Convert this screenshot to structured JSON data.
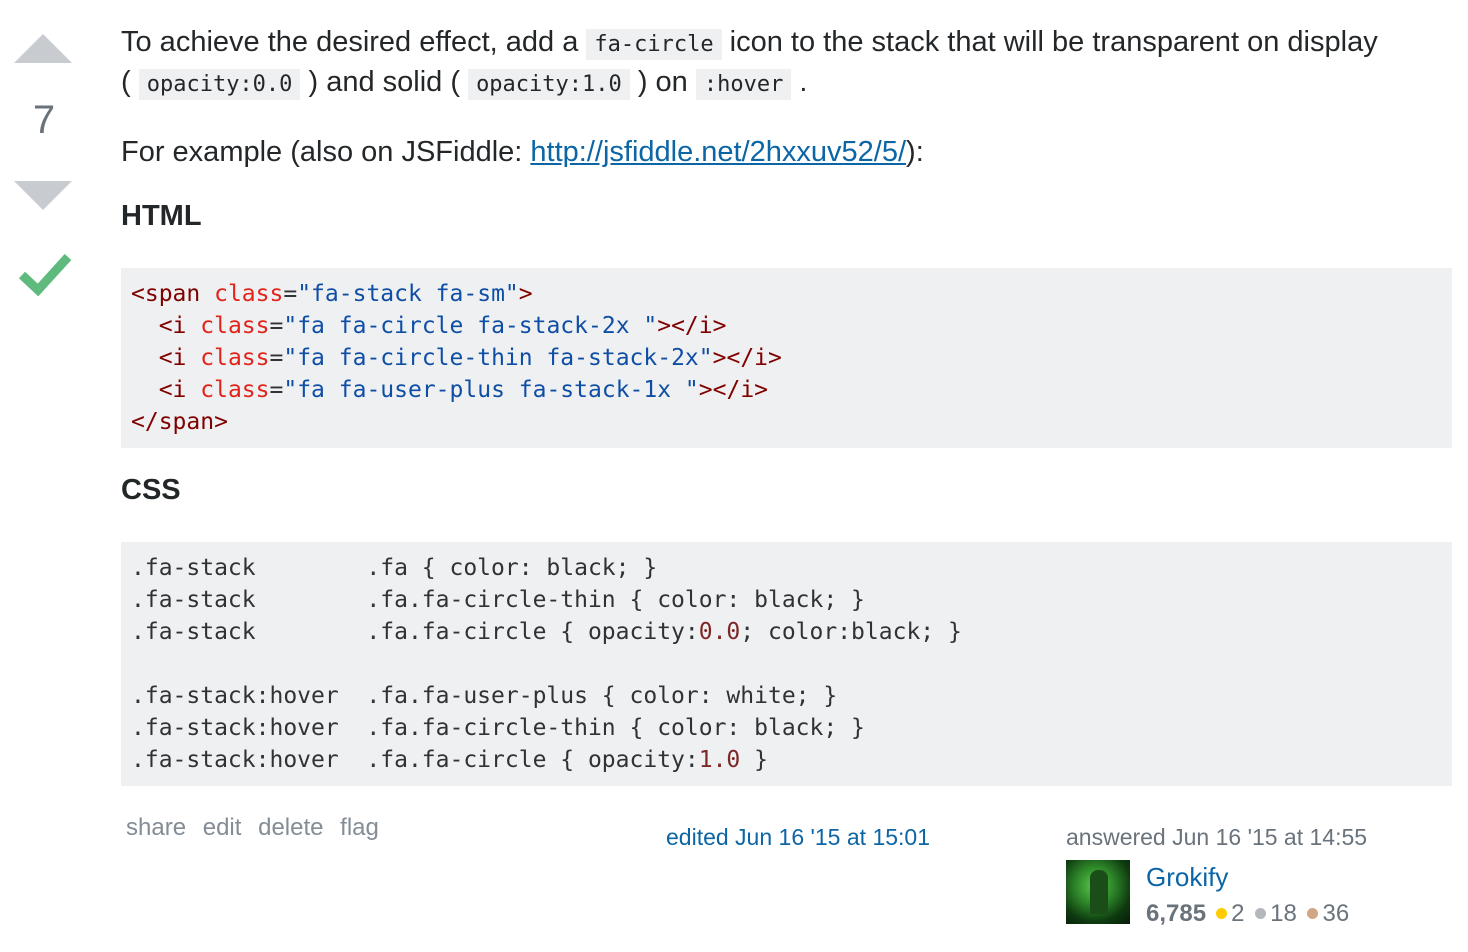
{
  "vote": {
    "count": "7"
  },
  "colors": {
    "accepted": "#5eba7d",
    "link": "#0c65a5",
    "gold": "#ffcc01",
    "silver": "#b4b8bc",
    "bronze": "#d1a684"
  },
  "body": {
    "p1": {
      "t1": "To achieve the desired effect, add a ",
      "c1": "fa-circle",
      "t2": " icon to the stack that will be transparent on display",
      "t3": "( ",
      "c2": "opacity:0.0",
      "t4": " ) and solid ( ",
      "c3": "opacity:1.0",
      "t5": " ) on ",
      "c4": ":hover",
      "t6": " ."
    },
    "p2": {
      "t1": "For example (also on JSFiddle: ",
      "link": "http://jsfiddle.net/2hxxuv52/5/",
      "t2": "):"
    },
    "heading_html": "HTML",
    "heading_css": "CSS"
  },
  "code_html": {
    "l1": {
      "open": "<span ",
      "attr": "class",
      "eq": "=",
      "val": "\"fa-stack fa-sm\"",
      "close": ">"
    },
    "l2": {
      "open": "  <i ",
      "attr": "class",
      "eq": "=",
      "val": "\"fa fa-circle fa-stack-2x \"",
      "close": "></i>"
    },
    "l3": {
      "open": "  <i ",
      "attr": "class",
      "eq": "=",
      "val": "\"fa fa-circle-thin fa-stack-2x\"",
      "close": "></i>"
    },
    "l4": {
      "open": "  <i ",
      "attr": "class",
      "eq": "=",
      "val": "\"fa fa-user-plus fa-stack-1x \"",
      "close": "></i>"
    },
    "l5": "</span>"
  },
  "code_css": {
    "l1": ".fa-stack        .fa { color: black; }",
    "l2": ".fa-stack        .fa.fa-circle-thin { color: black; }",
    "l3a": ".fa-stack        .fa.fa-circle { opacity:",
    "l3n": "0.0",
    "l3b": "; color:black; }",
    "l4": ".fa-stack:hover  .fa.fa-user-plus { color: white; }",
    "l5": ".fa-stack:hover  .fa.fa-circle-thin { color: black; }",
    "l6a": ".fa-stack:hover  .fa.fa-circle { opacity:",
    "l6n": "1.0",
    "l6b": " }"
  },
  "menu": {
    "share": "share",
    "edit": "edit",
    "delete": "delete",
    "flag": "flag"
  },
  "edited": "edited Jun 16 '15 at 15:01",
  "answered": "answered Jun 16 '15 at 14:55",
  "user": {
    "name": "Grokify",
    "rep": "6,785",
    "gold": "2",
    "silver": "18",
    "bronze": "36"
  }
}
